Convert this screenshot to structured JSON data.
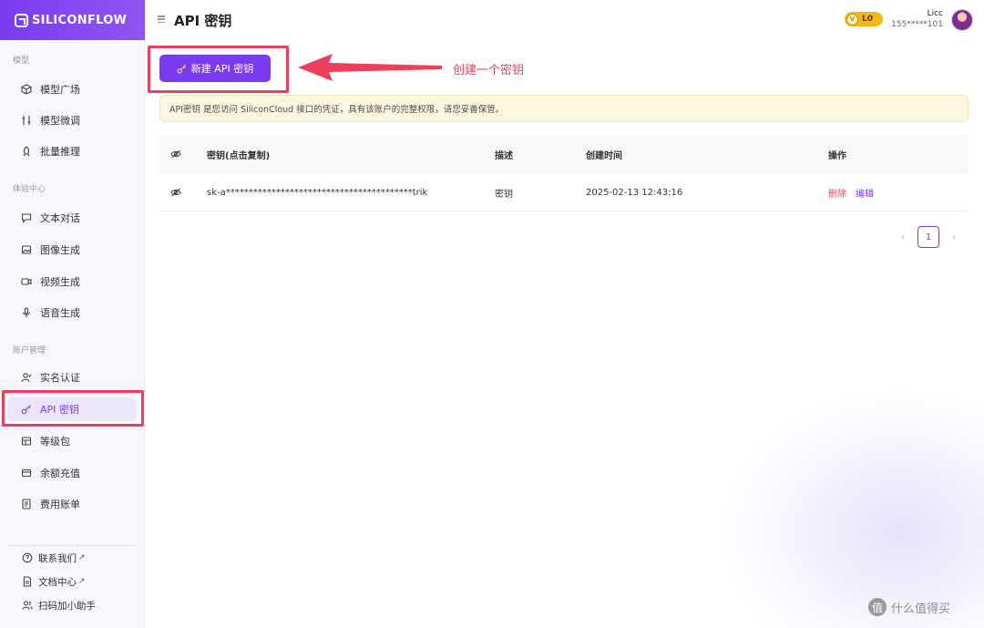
{
  "brand": {
    "name": "SILICONFLOW"
  },
  "sidebar": {
    "sections": [
      {
        "label": "模型"
      },
      {
        "label": "体验中心"
      },
      {
        "label": "账户管理"
      }
    ],
    "items": [
      {
        "label": "模型广场",
        "icon": "cube-icon"
      },
      {
        "label": "模型微调",
        "icon": "tune-icon"
      },
      {
        "label": "批量推理",
        "icon": "rocket-icon"
      },
      {
        "label": "文本对话",
        "icon": "chat-icon"
      },
      {
        "label": "图像生成",
        "icon": "image-icon"
      },
      {
        "label": "视频生成",
        "icon": "video-icon"
      },
      {
        "label": "语音生成",
        "icon": "mic-icon"
      },
      {
        "label": "实名认证",
        "icon": "user-check-icon"
      },
      {
        "label": "API 密钥",
        "icon": "key-icon"
      },
      {
        "label": "等级包",
        "icon": "package-icon"
      },
      {
        "label": "余额充值",
        "icon": "wallet-icon"
      },
      {
        "label": "费用账单",
        "icon": "bill-icon"
      }
    ],
    "bottom_items": [
      {
        "label": "联系我们",
        "ext": "↗"
      },
      {
        "label": "文档中心",
        "ext": "↗"
      },
      {
        "label": "扫码加小助手",
        "ext": ""
      }
    ]
  },
  "header": {
    "title": "API 密钥",
    "level": "L0",
    "user_name": "Licc",
    "user_phone": "155*****101"
  },
  "main": {
    "create_button": "新建 API 密钥",
    "annotation": "创建一个密钥",
    "notice": "API密钥 是您访问 SiliconCloud 接口的凭证，具有该账户的完整权限，请您妥善保管。",
    "table": {
      "headers": {
        "key": "密钥(点击复制)",
        "desc": "描述",
        "time": "创建时间",
        "action": "操作"
      },
      "rows": [
        {
          "key": "sk-a*****************************************trik",
          "desc": "密钥",
          "time": "2025-02-13 12:43:16",
          "delete": "删除",
          "edit": "编辑"
        }
      ]
    },
    "pagination": {
      "current": "1"
    }
  },
  "watermark": {
    "badge": "值",
    "text": "什么值得买"
  },
  "colors": {
    "accent": "#7a3bf0",
    "annotation": "#ef3e5c",
    "level": "#f6b61a"
  }
}
